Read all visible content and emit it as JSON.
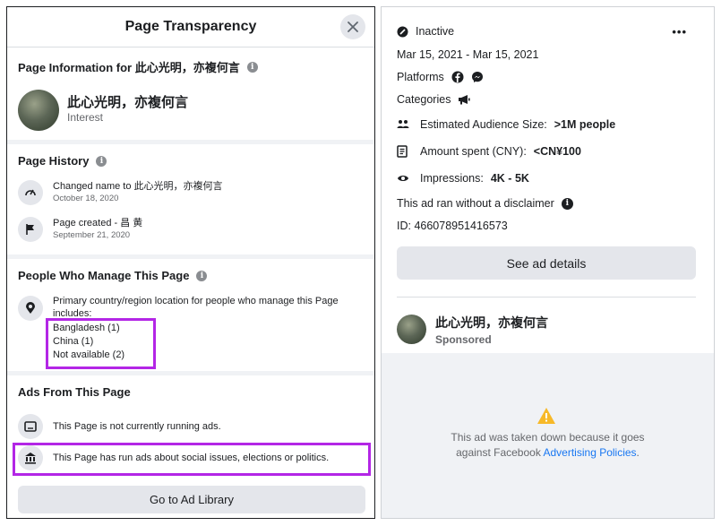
{
  "left": {
    "title": "Page Transparency",
    "page_info": {
      "heading": "Page Information for 此心光明，亦複何言",
      "page_name": "此心光明，亦複何言",
      "category": "Interest"
    },
    "history": {
      "heading": "Page History",
      "items": [
        {
          "main": "Changed name to 此心光明，亦複何言",
          "date": "October 18, 2020",
          "icon": "speedometer-icon"
        },
        {
          "main": "Page created - 昌 黄",
          "date": "September 21, 2020",
          "icon": "flag-icon"
        }
      ]
    },
    "managers": {
      "heading": "People Who Manage This Page",
      "intro": "Primary country/region location for people who manage this Page includes:",
      "countries": [
        "Bangladesh (1)",
        "China (1)",
        "Not available (2)"
      ]
    },
    "ads": {
      "heading": "Ads From This Page",
      "not_running": "This Page is not currently running ads.",
      "political": "This Page has run ads about social issues, elections or politics.",
      "button": "Go to Ad Library"
    },
    "highlight_color": "#b326e6"
  },
  "right": {
    "status": "Inactive",
    "more": "•••",
    "dates": "Mar 15, 2021 - Mar 15, 2021",
    "platforms_label": "Platforms",
    "platform_icons": [
      "facebook-icon",
      "messenger-icon"
    ],
    "categories_label": "Categories",
    "category_icon": "megaphone-icon",
    "audience_label": "Estimated Audience Size:",
    "audience_value": ">1M people",
    "spent_label": "Amount spent (CNY):",
    "spent_value": "<CN¥100",
    "impressions_label": "Impressions:",
    "impressions_value": "4K - 5K",
    "disclaimer": "This ad ran without a disclaimer",
    "id_line": "ID: 466078951416573",
    "details_button": "See ad details",
    "advertiser_name": "此心光明，亦複何言",
    "sponsored": "Sponsored",
    "takedown_line1": "This ad was taken down because it goes",
    "takedown_line2_prefix": "against Facebook ",
    "takedown_link": "Advertising Policies",
    "takedown_suffix": ".",
    "link_color": "#1877f2",
    "warning_color": "#f7b928"
  }
}
